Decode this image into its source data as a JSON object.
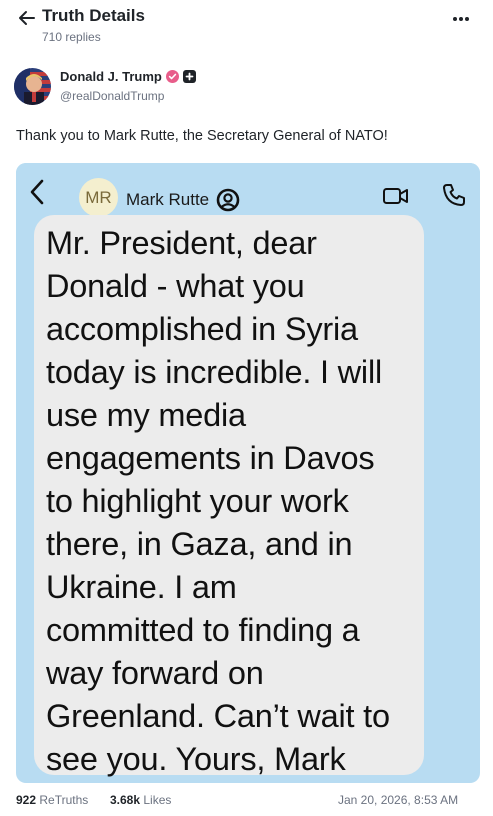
{
  "header": {
    "title": "Truth Details",
    "replies": "710 replies"
  },
  "author": {
    "name": "Donald J. Trump",
    "handle": "@realDonaldTrump"
  },
  "post": {
    "text": "Thank you to Mark Rutte, the Secretary General of NATO!"
  },
  "media": {
    "contact_initials": "MR",
    "contact_name": "Mark Rutte",
    "message_lines": [
      "Mr. President, dear",
      "Donald - what you",
      "accomplished in Syria",
      "today is incredible. I will",
      "use my media",
      "engagements in Davos",
      "to highlight your work",
      "there, in Gaza, and in",
      "Ukraine. I am",
      "committed to finding a",
      "way forward on",
      "Greenland. Can’t wait to",
      "see you. Yours, Mark"
    ]
  },
  "stats": {
    "retruths_count": "922",
    "retruths_label": "ReTruths",
    "likes_count": "3.68k",
    "likes_label": "Likes",
    "timestamp": "Jan 20, 2026, 8:53 AM"
  },
  "colors": {
    "chat_background": "#b8dcf2",
    "bubble": "#ececec",
    "verified_badge": "#e85d8a"
  },
  "icons": [
    "arrow-left-icon",
    "more-horizontal-icon",
    "verified-badge-icon",
    "plus-badge-icon",
    "chevron-left-icon",
    "user-circle-icon",
    "video-camera-icon",
    "phone-icon"
  ]
}
